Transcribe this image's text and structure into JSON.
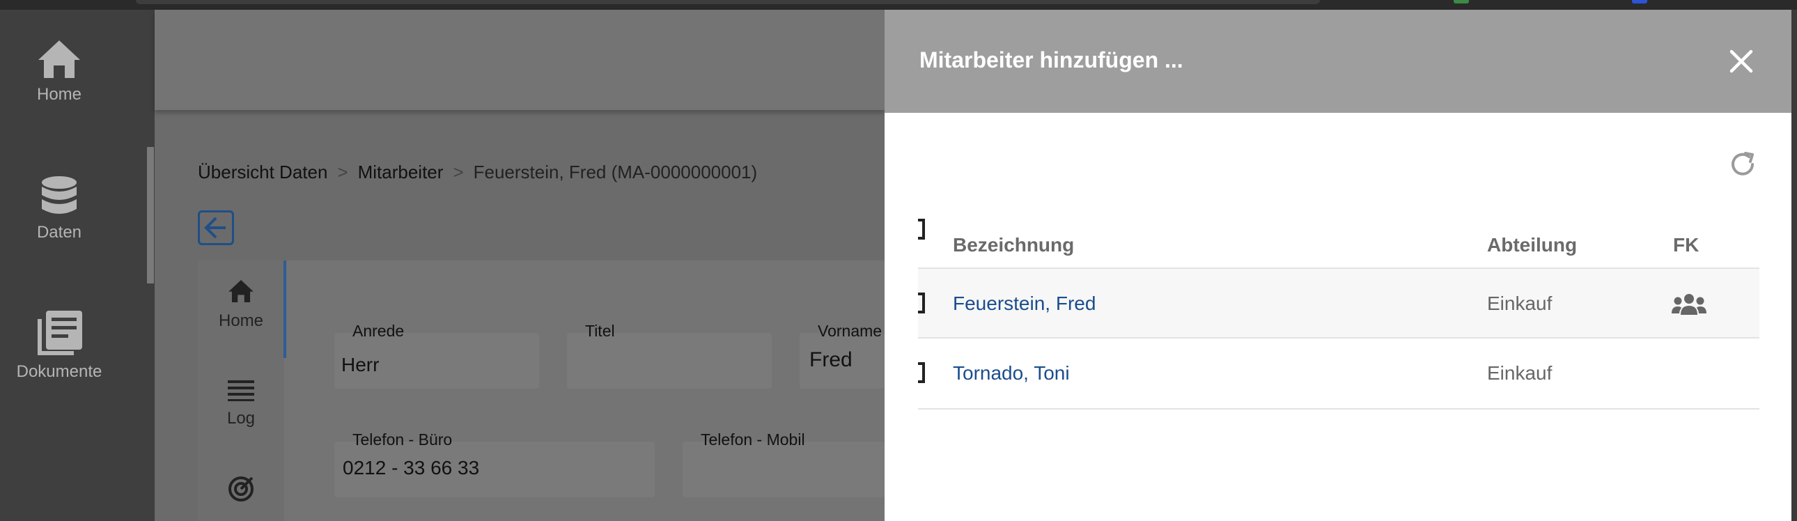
{
  "sidebar": {
    "items": [
      {
        "label": "Home",
        "icon": "home-icon"
      },
      {
        "label": "Daten",
        "icon": "database-icon"
      },
      {
        "label": "Dokumente",
        "icon": "documents-icon"
      }
    ]
  },
  "breadcrumb": {
    "items": [
      "Übersicht Daten",
      "Mitarbeiter",
      "Feuerstein, Fred (MA-0000000001)"
    ],
    "separator": ">"
  },
  "detail_nav": {
    "items": [
      {
        "label": "Home",
        "icon": "home-icon"
      },
      {
        "label": "Log",
        "icon": "list-icon"
      },
      {
        "label": "",
        "icon": "target-icon"
      }
    ]
  },
  "form": {
    "anrede": {
      "label": "Anrede",
      "value": "Herr"
    },
    "titel": {
      "label": "Titel",
      "value": ""
    },
    "vorname": {
      "label": "Vorname",
      "value": "Fred"
    },
    "telefon_buero": {
      "label": "Telefon - Büro",
      "value": "0212 - 33 66 33"
    },
    "telefon_mobil": {
      "label": "Telefon - Mobil",
      "value": ""
    }
  },
  "drawer": {
    "title": "Mitarbeiter hinzufügen ...",
    "columns": [
      "Bezeichnung",
      "Abteilung",
      "FK"
    ],
    "rows": [
      {
        "name": "Feuerstein, Fred",
        "department": "Einkauf",
        "fk": true
      },
      {
        "name": "Tornado, Toni",
        "department": "Einkauf",
        "fk": false
      }
    ]
  },
  "colors": {
    "accent": "#1b4d8c",
    "drawer_header": "#9e9e9e",
    "overlay_sidebar": "#3f3f3f"
  }
}
